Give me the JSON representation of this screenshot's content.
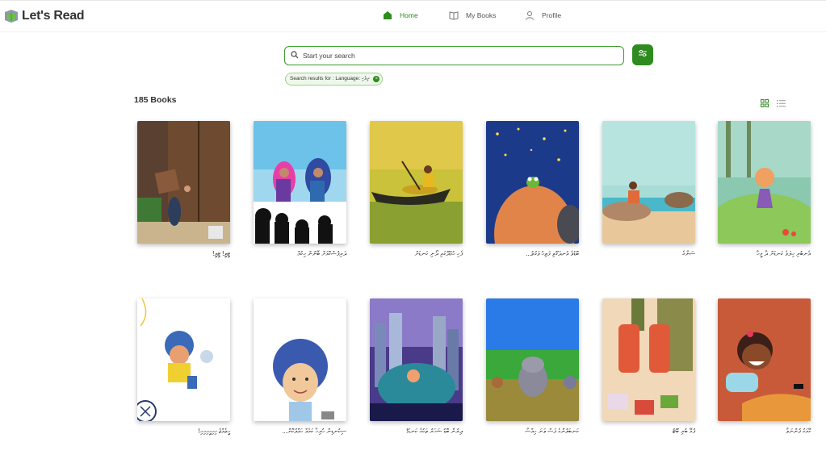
{
  "app": {
    "name": "Let's Read"
  },
  "nav": {
    "home": "Home",
    "my_books": "My Books",
    "profile": "Profile"
  },
  "search": {
    "placeholder": "Start your search"
  },
  "filter_chip": {
    "label": "Search results for : Language: ދިވެހި"
  },
  "results": {
    "count_label": "185 Books"
  },
  "colors": {
    "brand_green": "#2e8b1f",
    "chip_bg": "#eef8ea"
  },
  "books": [
    {
      "title": "ޓީވީ! ޓީވީ!"
    },
    {
      "title": "ދަރިފުސްކޮޅަށް ބޭނުން ހިކުމް"
    },
    {
      "title": "ފެހި ހުޅުދޫގައި ދޯނި ކަނޑަށް"
    },
    {
      "title": "ބޮޑުވެ އުނދަގޫވި ފަތިހު ވަގުތު..."
    },
    {
      "title": "ސަނާގެ"
    },
    {
      "title": "އެނބުރި ހިލަވެ ކަނޑަށް ދާ މީހާ"
    },
    {
      "title": "ހީވެއްޖެ ހިހިހީހިހިހި!"
    },
    {
      "title": "ސިކުނޑިން ހުރިހާ ކަމެއް ހައްލުކޮށް..."
    },
    {
      "title": "ދިރުން ބޮޑު ޝަހަރު ތަކުގެ ކަނޑު!"
    },
    {
      "title": "ކަނބަލުންގެ ފަސް ވަނަ ހިއްސާ"
    },
    {
      "title": "ފުމޭ ބުރި ބޫޓު"
    },
    {
      "title": "ގޭމަގު ފުންނަވާ"
    }
  ]
}
